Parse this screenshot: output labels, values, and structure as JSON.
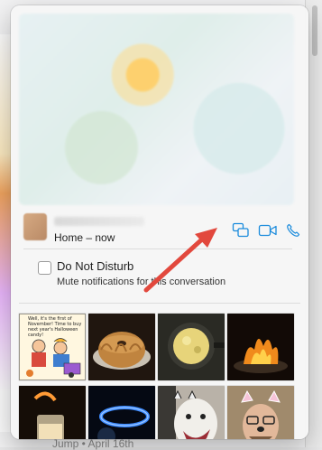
{
  "contact": {
    "location": "Home – now"
  },
  "actions": {
    "screen_share": "screen-share-icon",
    "video_call": "video-camera-icon",
    "phone_call": "phone-icon"
  },
  "dnd": {
    "label": "Do Not Disturb",
    "description": "Mute notifications for this conversation",
    "checked": false
  },
  "photos": {
    "comic_caption": "Well, it's the first of November! Time to buy next year's Halloween candy!"
  },
  "background": {
    "footer": "Jump • April 16th"
  },
  "colors": {
    "accent": "#1a8bdc",
    "annotation_arrow": "#e2483d"
  }
}
